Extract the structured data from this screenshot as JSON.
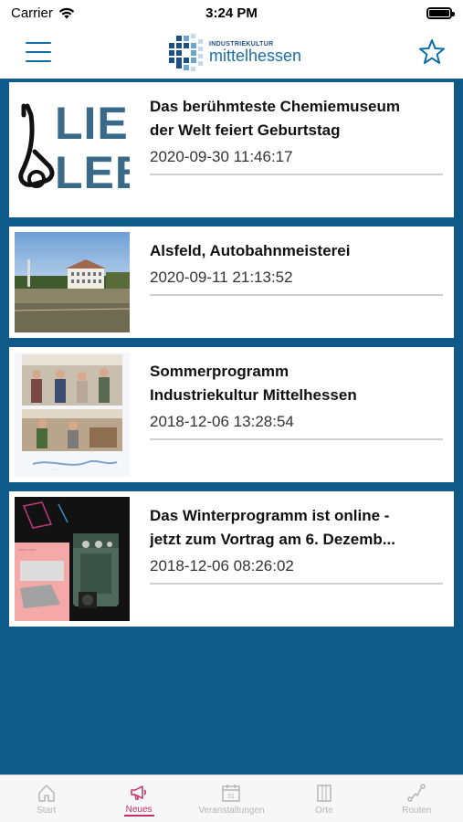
{
  "status_bar": {
    "carrier": "Carrier",
    "time": "3:24 PM"
  },
  "nav": {
    "logo_small": "INDUSTRIEKULTUR",
    "logo_big": "mittelhessen",
    "icons": [
      "hamburger-menu-icon",
      "star-icon"
    ]
  },
  "news": [
    {
      "title_line1": "Das berühmteste Chemiemuseum",
      "title_line2": "der Welt feiert Geburtstag",
      "date": "2020-09-30 11:46:17"
    },
    {
      "title_line1": "Alsfeld, Autobahnmeisterei",
      "title_line2": "",
      "date": "2020-09-11 21:13:52"
    },
    {
      "title_line1": "Sommerprogramm",
      "title_line2": "Industriekultur Mittelhessen",
      "date": "2018-12-06 13:28:54"
    },
    {
      "title_line1": "Das Winterprogramm ist online -",
      "title_line2": "jetzt zum Vortrag am 6. Dezemb...",
      "date": "2018-12-06 08:26:02"
    }
  ],
  "thumb1": {
    "text_top": "LIEB",
    "text_bottom": "LEB"
  },
  "tabs": [
    {
      "label": "Start",
      "icon": "home-icon",
      "active": false
    },
    {
      "label": "Neues",
      "icon": "megaphone-icon",
      "active": true
    },
    {
      "label": "Veranstaltungen",
      "icon": "calendar-icon",
      "active": false
    },
    {
      "label": "Orte",
      "icon": "building-icon",
      "active": false
    },
    {
      "label": "Routen",
      "icon": "route-icon",
      "active": false
    }
  ],
  "colors": {
    "primary_blue": "#0f5a88",
    "accent_pink": "#c0306a",
    "inactive_gray": "#b5b5b5"
  }
}
